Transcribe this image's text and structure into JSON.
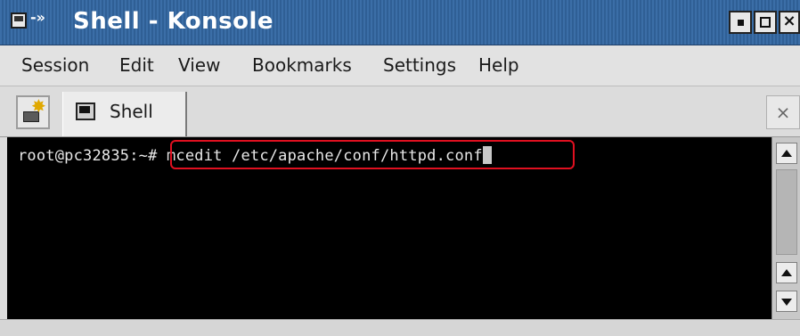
{
  "window": {
    "title": "Shell - Konsole",
    "title_arrow": "-»"
  },
  "menubar": {
    "items": [
      "Session",
      "Edit",
      "View",
      "Bookmarks",
      "Settings",
      "Help"
    ]
  },
  "tabs": [
    {
      "label": "Shell"
    }
  ],
  "terminal": {
    "prompt": "root@pc32835:~# ",
    "command": "mcedit /etc/apache/conf/httpd.conf"
  },
  "colors": {
    "titlebar": "#3b6ea7",
    "terminal_bg": "#000000",
    "highlight": "#e01020"
  }
}
